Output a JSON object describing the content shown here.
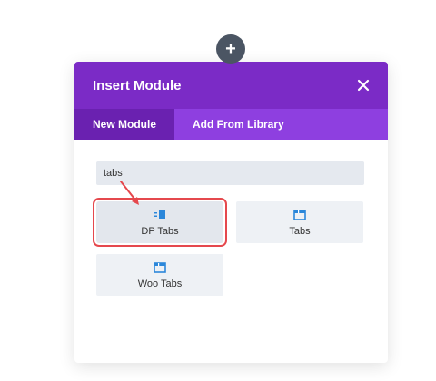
{
  "add_button": {
    "symbol": "+"
  },
  "modal": {
    "title": "Insert Module",
    "tabs": [
      {
        "label": "New Module",
        "active": true
      },
      {
        "label": "Add From Library",
        "active": false
      }
    ],
    "search": {
      "value": "tabs",
      "placeholder": ""
    },
    "modules": [
      {
        "label": "DP Tabs",
        "icon": "dp-tabs-icon",
        "highlighted": true
      },
      {
        "label": "Tabs",
        "icon": "tabs-icon",
        "highlighted": false
      },
      {
        "label": "Woo Tabs",
        "icon": "tabs-icon",
        "highlighted": false
      }
    ]
  },
  "colors": {
    "header": "#7b2bc6",
    "tab_bar": "#8e3fe0",
    "tab_active": "#6a21b0",
    "icon_blue": "#2b87da",
    "highlight": "#e5484d",
    "add_button": "#4b5563"
  }
}
